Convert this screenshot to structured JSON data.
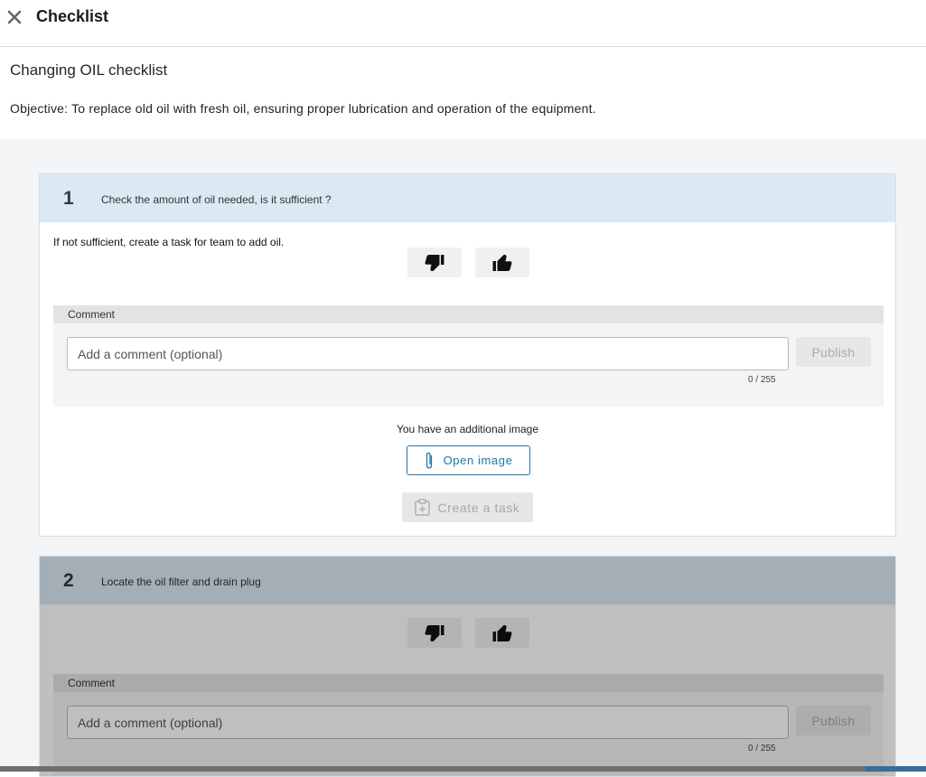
{
  "header": {
    "title": "Checklist"
  },
  "checklist": {
    "title": "Changing OIL checklist",
    "objective": "Objective: To replace old oil with fresh oil, ensuring proper lubrication and operation of the equipment."
  },
  "items": [
    {
      "number": "1",
      "question": "Check the amount of oil needed, is it sufficient ?",
      "description": "If not sufficient, create a task for team to add oil.",
      "comment_label": "Comment",
      "comment_placeholder": "Add a comment (optional)",
      "publish_label": "Publish",
      "char_count": "0 / 255",
      "additional_image_text": "You have an additional image",
      "open_image_label": "Open image",
      "create_task_label": "Create a task"
    },
    {
      "number": "2",
      "question": "Locate the oil filter and drain plug",
      "comment_label": "Comment",
      "comment_placeholder": "Add a comment (optional)",
      "publish_label": "Publish",
      "char_count": "0 / 255"
    }
  ],
  "icons": {
    "close": "close-icon",
    "thumbs_down": "thumbs-down-icon",
    "thumbs_up": "thumbs-up-icon",
    "attachment": "paperclip-icon",
    "task": "clipboard-plus-icon"
  },
  "colors": {
    "accent": "#2176a8",
    "card_header": "#dbe9f3",
    "disabled_text": "#a9a9a9"
  }
}
